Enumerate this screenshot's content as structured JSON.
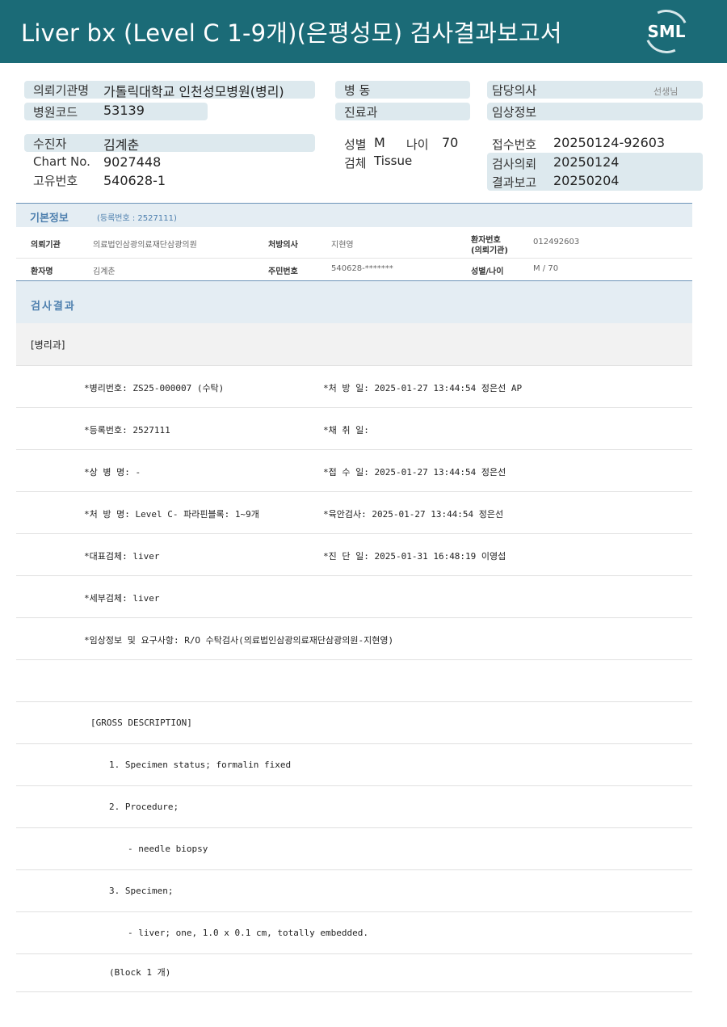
{
  "header": {
    "title": "Liver bx (Level C 1-9개)(은평성모) 검사결과보고서",
    "logo_text": "SML"
  },
  "summary": {
    "institution_label": "의뢰기관명",
    "institution_value": "가톨릭대학교 인천성모병원(병리)",
    "hospital_code_label": "병원코드",
    "hospital_code_value": "53139",
    "ward_label": "병 동",
    "department_label": "진료과",
    "doctor_label": "담당의사",
    "doctor_suffix": "선생님",
    "clinical_info_label": "임상정보",
    "patient_label": "수진자",
    "patient_value": "김계춘",
    "chart_label": "Chart No.",
    "chart_value": "9027448",
    "unique_label": "고유번호",
    "unique_value": "540628-1",
    "sex_label": "성별",
    "sex_value": "M",
    "age_label": "나이",
    "age_value": "70",
    "specimen_label": "검체",
    "specimen_value": "Tissue",
    "receipt_label": "접수번호",
    "receipt_value": "20250124-92603",
    "request_label": "검사의뢰",
    "request_value": "20250124",
    "report_label": "결과보고",
    "report_value": "20250204"
  },
  "basic_info": {
    "title": "기본정보",
    "reg_no": "(등록번호 : 2527111)",
    "inst_key": "의뢰기관",
    "inst_val": "의료법인삼광의료재단삼광의원",
    "presc_key": "처방의사",
    "presc_val": "지현영",
    "ptno_key_1": "환자번호",
    "ptno_key_2": "(의뢰기관)",
    "ptno_val": "012492603",
    "name_key": "환자명",
    "name_val": "김계춘",
    "rrn_key": "주민번호",
    "rrn_val": "540628-*******",
    "sexage_key": "성별/나이",
    "sexage_val": "M / 70"
  },
  "results": {
    "title": "검사결과",
    "department": "[병리과]",
    "rows": [
      [
        "*병리번호: ZS25-000007 (수탁)",
        "*처 방 일: 2025-01-27 13:44:54  정은선 AP"
      ],
      [
        "*등록번호: 2527111",
        "*채 취 일:"
      ],
      [
        "*상 병 명: -",
        "*접 수 일: 2025-01-27 13:44:54  정은선"
      ],
      [
        "*처 방 명: Level C- 파라핀블록: 1~9개",
        "*육안검사: 2025-01-27 13:44:54  정은선"
      ],
      [
        "*대표검체: liver",
        "*진 단 일: 2025-01-31 16:48:19  이영섭"
      ],
      [
        "*세부검체: liver",
        ""
      ],
      [
        "*임상정보 및 요구사항: R/O 수탁검사(의료법인삼광의료재단삼광의원-지현영)",
        ""
      ],
      [
        "",
        ""
      ]
    ],
    "gross": [
      "[GROSS DESCRIPTION]",
      "1. Specimen status; formalin fixed",
      "2. Procedure;",
      "- needle biopsy",
      "3. Specimen;",
      "- liver; one, 1.0 x 0.1 cm, totally embedded.",
      "(Block 1 개)"
    ]
  }
}
